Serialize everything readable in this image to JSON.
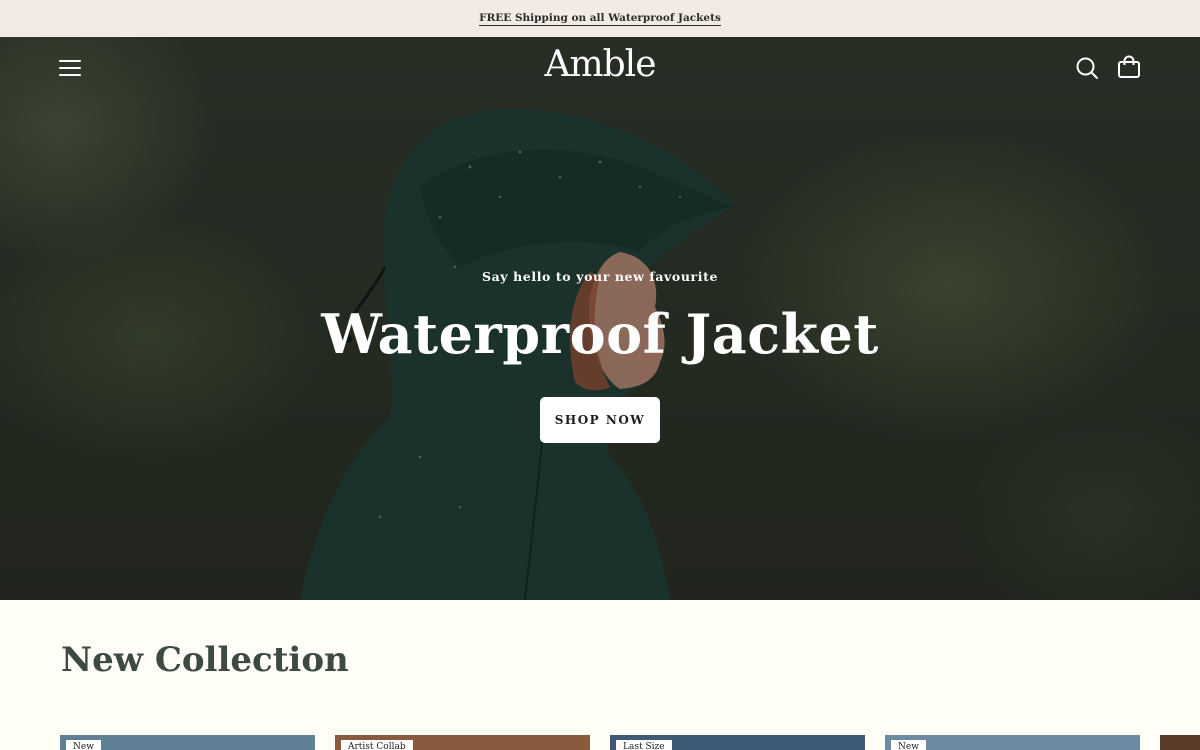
{
  "announcement": {
    "text": "FREE Shipping on all Waterproof Jackets"
  },
  "header": {
    "logo": "Amble",
    "menu_icon": "menu-icon",
    "search_icon": "search-icon",
    "cart_icon": "shopping-bag-icon"
  },
  "hero": {
    "subtitle": "Say hello to your new favourite",
    "title": "Waterproof Jacket",
    "cta_label": "SHOP NOW"
  },
  "collection": {
    "title": "New Collection",
    "cards": [
      {
        "badge": "New",
        "color": "#5f7f95"
      },
      {
        "badge": "Artist Collab",
        "color": "#8a5a3e"
      },
      {
        "badge": "Last Size",
        "color": "#3e5a78"
      },
      {
        "badge": "New",
        "color": "#6d8aa3"
      },
      {
        "badge": "",
        "color": "#5a3a28"
      }
    ]
  },
  "colors": {
    "announcement_bg": "#f1ebe4",
    "page_bg": "#fefdf6",
    "heading": "#3c4a3f",
    "jacket": "#1f3a33"
  }
}
